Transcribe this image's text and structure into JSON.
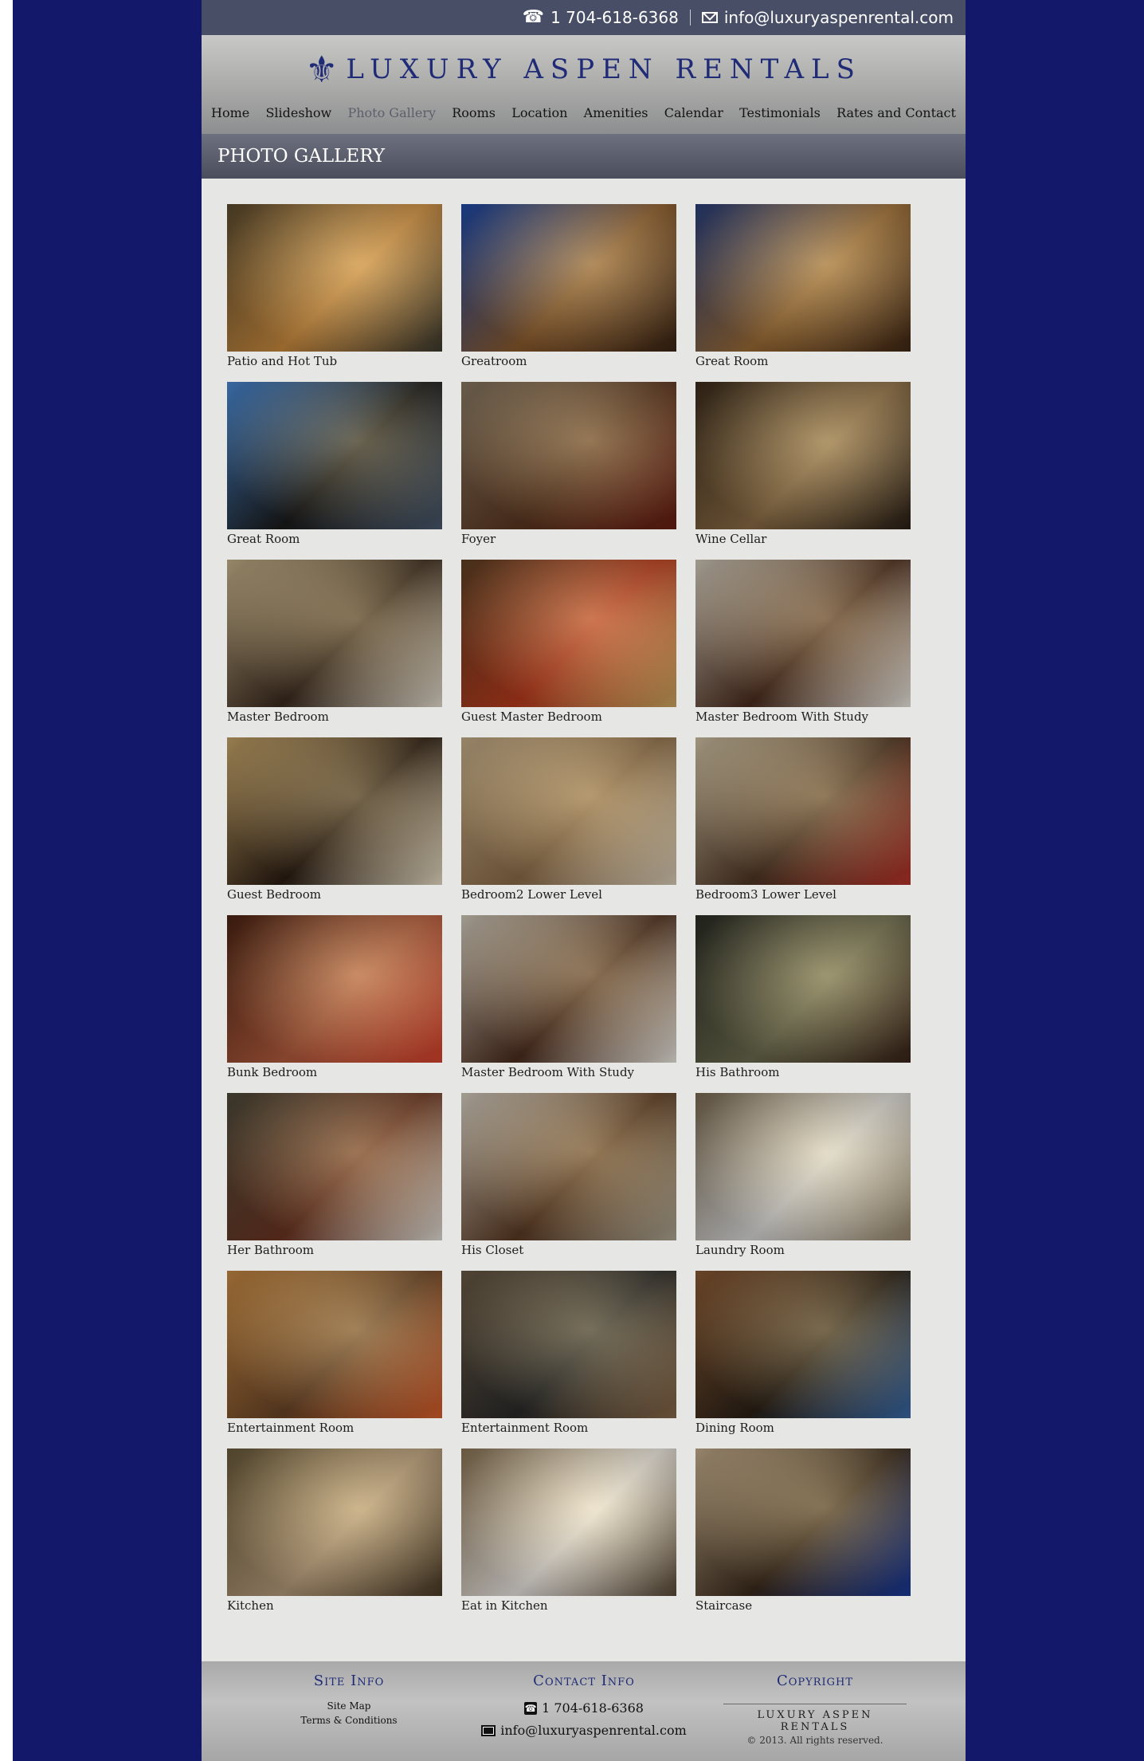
{
  "topbar": {
    "phone": "1 704-618-6368",
    "email": "info@luxuryaspenrental.com"
  },
  "header": {
    "brand": "LUXURY ASPEN RENTALS",
    "logo_icon": "fleur-de-lis-icon"
  },
  "nav": [
    {
      "label": "Home",
      "active": false
    },
    {
      "label": "Slideshow",
      "active": false
    },
    {
      "label": "Photo Gallery",
      "active": true
    },
    {
      "label": "Rooms",
      "active": false
    },
    {
      "label": "Location",
      "active": false
    },
    {
      "label": "Amenities",
      "active": false
    },
    {
      "label": "Calendar",
      "active": false
    },
    {
      "label": "Testimonials",
      "active": false
    },
    {
      "label": "Rates and Contact",
      "active": false
    }
  ],
  "page_title": "PHOTO GALLERY",
  "gallery": [
    {
      "caption": "Patio and Hot Tub",
      "tone": [
        "#5a4a2e",
        "#c98a3e",
        "#3c3a2f"
      ]
    },
    {
      "caption": "Greatroom",
      "tone": [
        "#1d49a8",
        "#8a5a2c",
        "#3a2414"
      ]
    },
    {
      "caption": "Great Room",
      "tone": [
        "#2a3f7a",
        "#9a6a34",
        "#3f2714"
      ]
    },
    {
      "caption": "Great Room",
      "tone": [
        "#4a8ad6",
        "#1a1a1a",
        "#4a5a6e"
      ]
    },
    {
      "caption": "Foyer",
      "tone": [
        "#8a7a64",
        "#5a3620",
        "#6a1e12"
      ]
    },
    {
      "caption": "Wine Cellar",
      "tone": [
        "#3b2c1c",
        "#8a6b45",
        "#2a2016"
      ]
    },
    {
      "caption": "Master Bedroom",
      "tone": [
        "#c9b48c",
        "#3a2a1e",
        "#e8e0d0"
      ]
    },
    {
      "caption": "Guest Master Bedroom",
      "tone": [
        "#5e4024",
        "#b6391c",
        "#cfa860"
      ]
    },
    {
      "caption": "Master Bedroom With Study",
      "tone": [
        "#d4ccbc",
        "#4a2c1e",
        "#eeeae2"
      ]
    },
    {
      "caption": "Guest Bedroom",
      "tone": [
        "#c9a66a",
        "#2a1c12",
        "#ece0c8"
      ]
    },
    {
      "caption": "Bedroom2 Lower Level",
      "tone": [
        "#c8b08a",
        "#8a6a48",
        "#dccfb8"
      ]
    },
    {
      "caption": "Bedroom3 Lower Level",
      "tone": [
        "#d2c4a6",
        "#4e3524",
        "#b8342a"
      ]
    },
    {
      "caption": "Bunk Bedroom",
      "tone": [
        "#4c2414",
        "#b05a3c",
        "#d8442e"
      ]
    },
    {
      "caption": "Master Bedroom With Study",
      "tone": [
        "#d4ccbc",
        "#4a2c1e",
        "#eeeae2"
      ]
    },
    {
      "caption": "His Bathroom",
      "tone": [
        "#2a2c24",
        "#6a6a4e",
        "#3a2418"
      ]
    },
    {
      "caption": "Her Bathroom",
      "tone": [
        "#4e4a3a",
        "#6a3422",
        "#e4e0d8"
      ]
    },
    {
      "caption": "His Closet",
      "tone": [
        "#d8d0c2",
        "#5a3a24",
        "#b0a894"
      ]
    },
    {
      "caption": "Laundry Room",
      "tone": [
        "#7a6a52",
        "#d8d8d8",
        "#9a8a6e"
      ]
    },
    {
      "caption": "Entertainment Room",
      "tone": [
        "#c88a44",
        "#6a4426",
        "#d8602c"
      ]
    },
    {
      "caption": "Entertainment Room",
      "tone": [
        "#6a5a46",
        "#2a2a2a",
        "#8a6a4a"
      ]
    },
    {
      "caption": "Dining Room",
      "tone": [
        "#8a5a34",
        "#2a2016",
        "#3a6aa8"
      ]
    },
    {
      "caption": "Kitchen",
      "tone": [
        "#6a5a3a",
        "#b49a7a",
        "#4a3a26"
      ]
    },
    {
      "caption": "Eat in Kitchen",
      "tone": [
        "#8a7454",
        "#e8e4e0",
        "#5a4a36"
      ]
    },
    {
      "caption": "Staircase",
      "tone": [
        "#c8b08e",
        "#3a2a1c",
        "#1a3a9a"
      ]
    }
  ],
  "footer": {
    "site_info_title": "Site Info",
    "site_map": "Site Map",
    "terms": "Terms & Conditions",
    "contact_title": "Contact Info",
    "phone": "1 704-618-6368",
    "email": "info@luxuryaspenrental.com",
    "copyright_title": "Copyright",
    "copyright_brand": "LUXURY ASPEN RENTALS",
    "copyright_text": "© 2013. All rights reserved."
  }
}
